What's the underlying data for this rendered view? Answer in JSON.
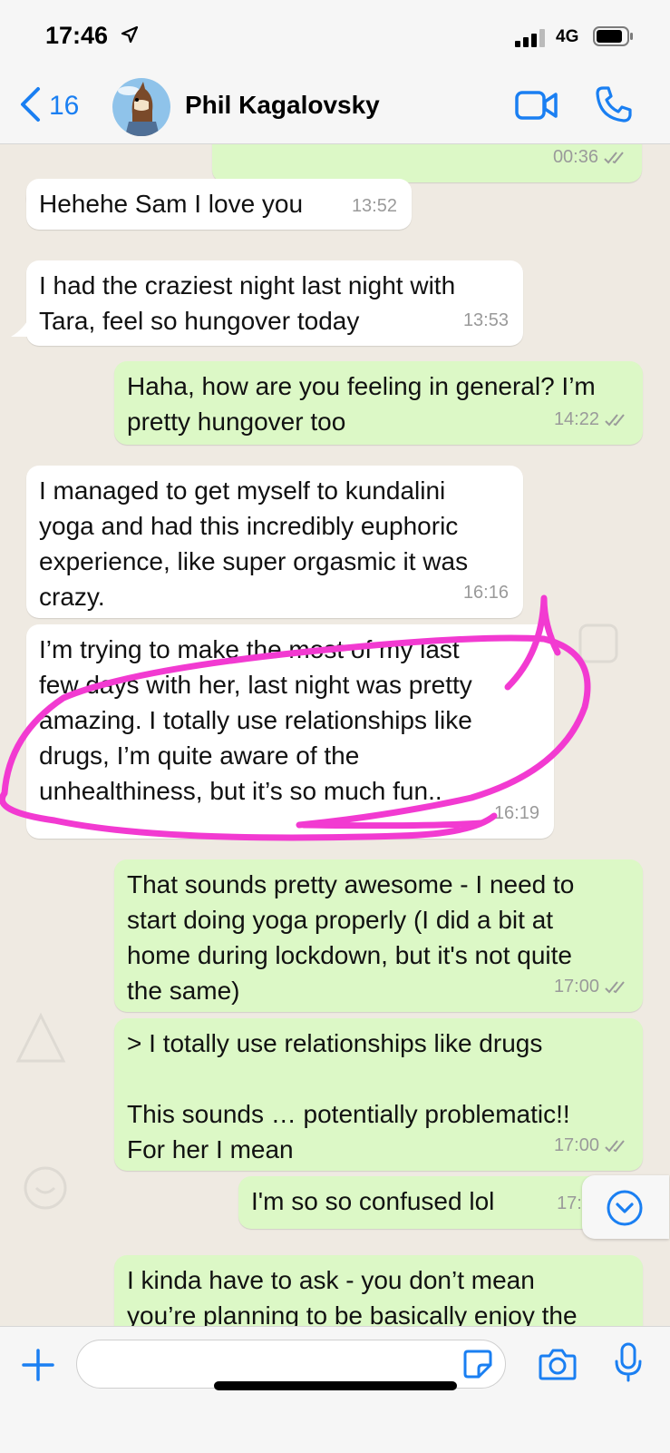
{
  "status_bar": {
    "time": "17:46",
    "network": "4G"
  },
  "header": {
    "back_count": "16",
    "contact_name": "Phil Kagalovsky"
  },
  "messages": [
    {
      "dir": "out",
      "text": "",
      "time": "00:36"
    },
    {
      "dir": "in",
      "text": "Hehehe Sam I love you",
      "time": "13:52"
    },
    {
      "dir": "in",
      "text": "I had the craziest night last night with\nTara, feel so hungover today",
      "time": "13:53"
    },
    {
      "dir": "out",
      "text": "Haha, how are you feeling in general? I’m\npretty hungover too",
      "time": "14:22"
    },
    {
      "dir": "in",
      "text": "I managed to get myself to kundalini\nyoga and had this incredibly euphoric\nexperience, like super orgasmic it was\ncrazy.",
      "time": "16:16"
    },
    {
      "dir": "in",
      "text": "I’m trying to make the most of my last\nfew days with her, last night was pretty\namazing. I totally use relationships like\ndrugs, I’m quite aware of the\nunhealthiness, but it’s so much fun..",
      "time": "16:19"
    },
    {
      "dir": "out",
      "text": "That sounds pretty awesome - I need to\nstart doing yoga properly (I did a bit at\nhome during lockdown, but it's not quite\nthe same)",
      "time": "17:00"
    },
    {
      "dir": "out",
      "text": "> I totally use relationships like drugs\n\nThis sounds … potentially problematic!!\nFor her I mean",
      "time": "17:00"
    },
    {
      "dir": "out",
      "text": "I'm so so confused lol",
      "time": "17:0"
    },
    {
      "dir": "out",
      "text": "I kinda have to ask - you don’t mean\nyou’re planning to be basically enjoy the",
      "time": ""
    }
  ],
  "input": {
    "placeholder": ""
  },
  "colors": {
    "accent": "#1a7ff2",
    "outgoing_bubble": "#dcf8c6",
    "incoming_bubble": "#ffffff",
    "annotation": "#f23ad1",
    "read_ticks": "#9a9a9a"
  },
  "icons": [
    "location-arrow-icon",
    "signal-icon",
    "battery-icon",
    "chevron-left-icon",
    "video-call-icon",
    "phone-icon",
    "chevron-down-icon",
    "plus-icon",
    "sticker-icon",
    "camera-icon",
    "microphone-icon"
  ]
}
